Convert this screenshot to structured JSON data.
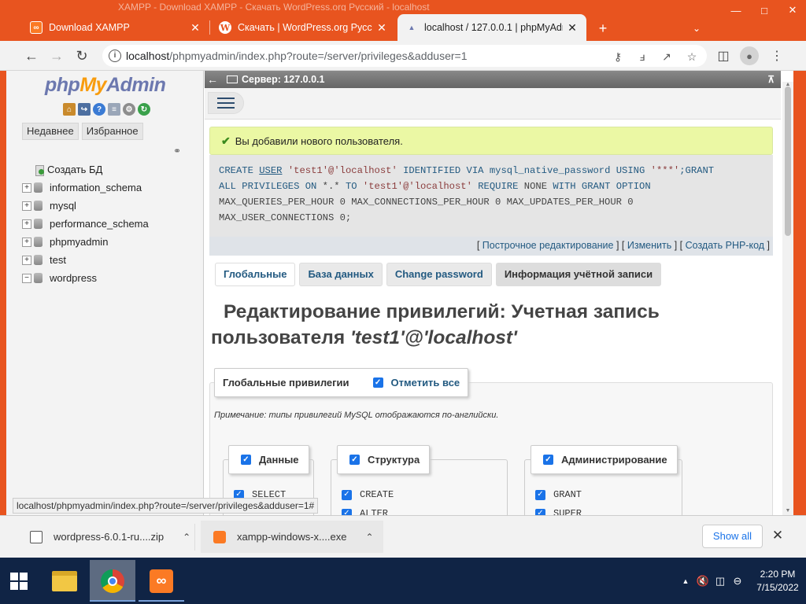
{
  "window": {
    "title": "XAMPP - Download XAMPP - Скачать WordPress.org Русский - localhost"
  },
  "tabs": [
    {
      "title": "Download XAMPP",
      "icon": "xampp-icon"
    },
    {
      "title": "Скачать | WordPress.org Русский",
      "icon": "wordpress-icon"
    },
    {
      "title": "localhost / 127.0.0.1 | phpMyAdmin",
      "icon": "phpmyadmin-icon"
    }
  ],
  "address_bar": {
    "url_host": "localhost",
    "url_path": "/phpmyadmin/index.php?route=/server/privileges&adduser=1"
  },
  "pma_nav": {
    "logo": {
      "php": "php",
      "my": "My",
      "admin": "Admin"
    },
    "tabs": [
      "Недавнее",
      "Избранное"
    ],
    "tree": [
      {
        "label": "Создать БД"
      },
      {
        "label": "information_schema"
      },
      {
        "label": "mysql"
      },
      {
        "label": "performance_schema"
      },
      {
        "label": "phpmyadmin"
      },
      {
        "label": "test"
      },
      {
        "label": "wordpress"
      }
    ]
  },
  "pma_main": {
    "breadcrumb": "Сервер: 127.0.0.1",
    "success_message": "Вы добавили нового пользователя.",
    "sql": {
      "line1": [
        "CREATE",
        "USER",
        "'test1'@'localhost'",
        "IDENTIFIED VIA mysql_native_password USING",
        "'***'",
        ";GRANT"
      ],
      "line2": [
        "ALL PRIVILEGES ON",
        "*.*",
        "TO",
        "'test1'@'localhost'",
        "REQUIRE",
        "NONE",
        "WITH GRANT OPTION"
      ],
      "line3": "MAX_QUERIES_PER_HOUR 0 MAX_CONNECTIONS_PER_HOUR 0 MAX_UPDATES_PER_HOUR 0",
      "line4": "MAX_USER_CONNECTIONS 0;"
    },
    "sql_links": {
      "inline_edit": "Построчное редактирование",
      "edit": "Изменить",
      "create_php": "Создать PHP-код"
    },
    "subtabs": [
      "Глобальные",
      "База данных",
      "Change password",
      "Информация учётной записи"
    ],
    "edit_title": {
      "prefix": "Редактирование привилегий: Учетная запись пользователя",
      "account": "'test1'@'localhost'"
    },
    "global_privileges": {
      "legend": "Глобальные привилегии",
      "check_all": "Отметить все",
      "note": "Примечание: типы привилегий MySQL отображаются по-английски.",
      "groups": [
        {
          "label": "Данные",
          "items": [
            "SELECT"
          ]
        },
        {
          "label": "Структура",
          "items": [
            "CREATE",
            "ALTER"
          ]
        },
        {
          "label": "Администрирование",
          "items": [
            "GRANT",
            "SUPER"
          ]
        }
      ]
    }
  },
  "status_bar_url": "localhost/phpmyadmin/index.php?route=/server/privileges&adduser=1#",
  "downloads": [
    {
      "filename": "wordpress-6.0.1-ru....zip"
    },
    {
      "filename": "xampp-windows-x....exe"
    }
  ],
  "downloads_show_all": "Show all",
  "taskbar": {
    "apps": [
      "file-explorer",
      "chrome",
      "xampp"
    ],
    "time": "2:20 PM",
    "date": "7/15/2022"
  }
}
